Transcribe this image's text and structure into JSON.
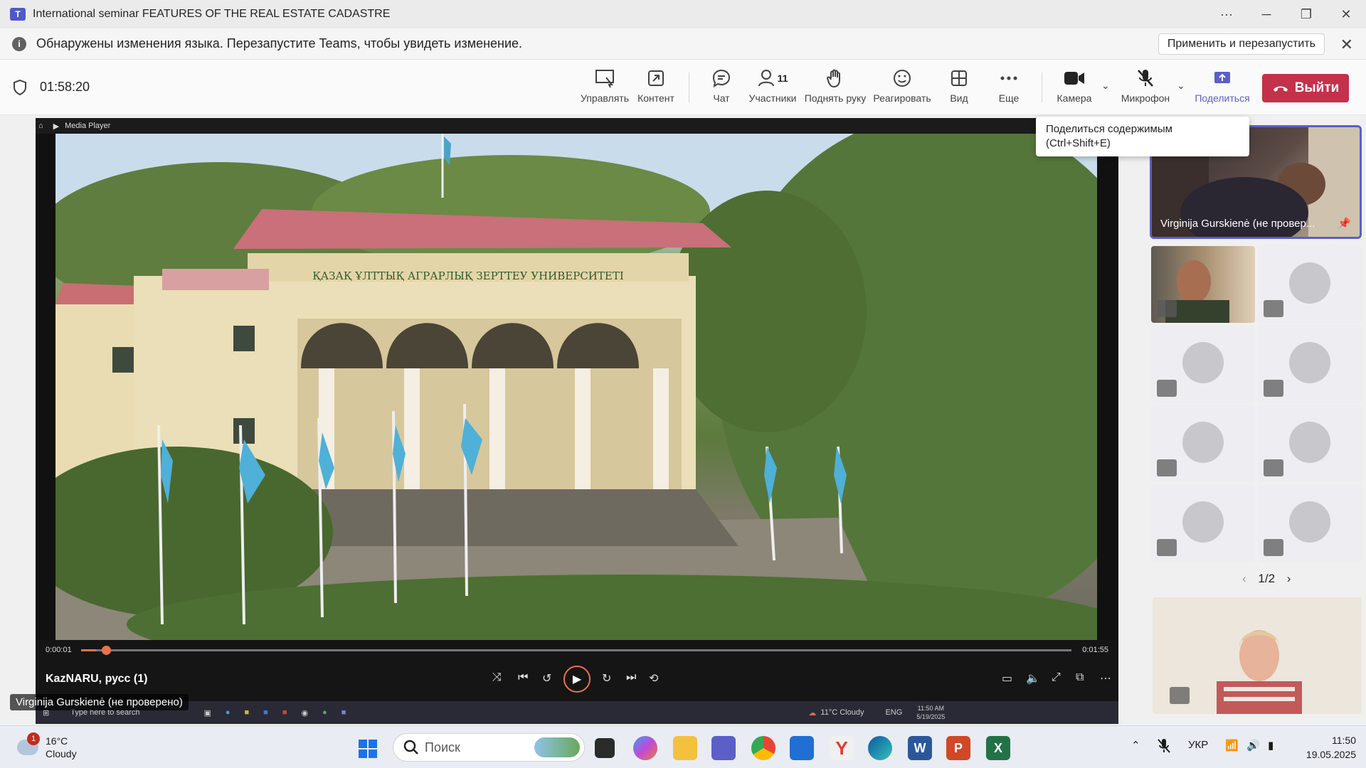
{
  "window": {
    "title": "International seminar FEATURES OF THE REAL ESTATE CADASTRE",
    "controls": {
      "more": "···",
      "minimize": "─",
      "restore": "❐",
      "close": "✕"
    }
  },
  "notification": {
    "text": "Обнаружены изменения языка. Перезапустите Teams, чтобы увидеть изменение.",
    "button": "Применить и перезапустить",
    "close": "✕"
  },
  "toolbar": {
    "timer": "01:58:20",
    "manage": "Управлять",
    "content": "Контент",
    "chat": "Чат",
    "participants": "Участники",
    "participants_count": "11",
    "raise_hand": "Поднять руку",
    "react": "Реагировать",
    "view": "Вид",
    "more": "Еще",
    "camera": "Камера",
    "mic": "Микрофон",
    "share": "Поделиться",
    "leave": "Выйти"
  },
  "tooltip": {
    "line1": "Поделиться содержимым",
    "line2": "(Ctrl+Shift+E)"
  },
  "media_player": {
    "app_name": "Media Player",
    "time_current": "0:00:01",
    "time_total": "0:01:55",
    "progress": 0.015,
    "video_title": "KazNARU, русс  (1)",
    "building_sign": "ҚАЗАҚ ҰЛТТЫҚ АГРАРЛЫҚ ЗЕРТТЕУ УНИВЕРСИТЕТІ"
  },
  "remote_taskbar": {
    "search_placeholder": "Type here to search",
    "weather": "11°C  Cloudy",
    "lang": "ENG",
    "time": "11:50 AM",
    "date": "5/19/2025"
  },
  "speaker_label": "Virginija Gurskienė (не проверено)",
  "gallery": {
    "main_tile_name": "Virginija Gurskienė (не провер...",
    "page": "1/2"
  },
  "taskbar": {
    "weather_temp": "16°C",
    "weather_cond": "Cloudy",
    "weather_badge": "1",
    "search_placeholder": "Поиск",
    "lang": "УКР",
    "time": "11:50",
    "date": "19.05.2025"
  },
  "colors": {
    "accent": "#5b5fc7",
    "leave": "#c4314b",
    "progress": "#e8734a"
  }
}
